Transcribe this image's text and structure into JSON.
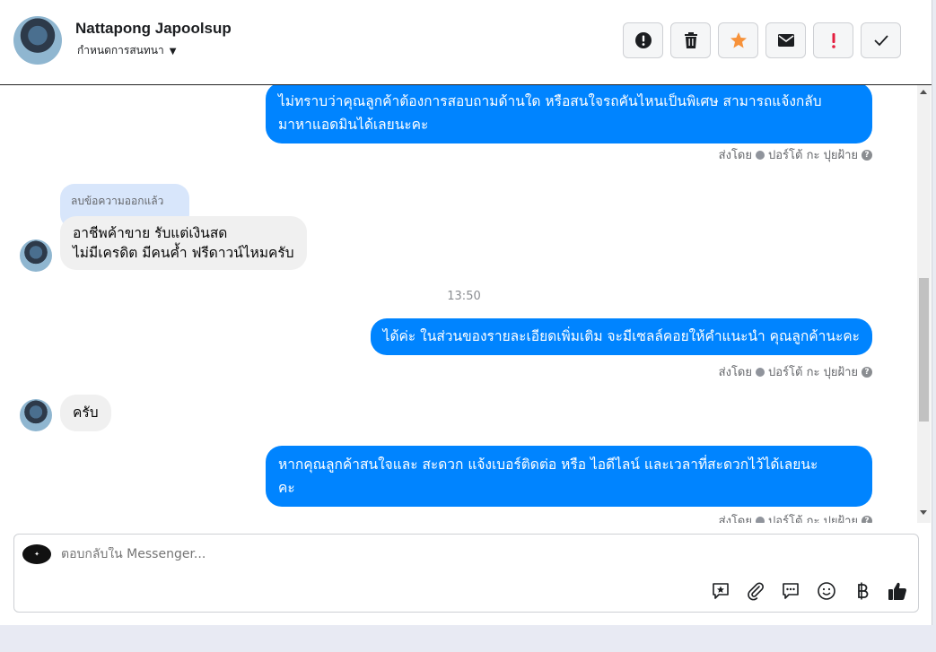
{
  "header": {
    "name": "Nattapong Japoolsup",
    "subtitle": "กำหนดการสนทนา",
    "actions": [
      "info-icon",
      "trash-icon",
      "star-icon",
      "mail-icon",
      "exclamation-icon",
      "check-icon"
    ],
    "star_color": "#f7923a",
    "exclamation_color": "#e41e3f"
  },
  "messages": {
    "m1": {
      "line1": "ไม่ทราบว่าคุณลูกค้าต้องการสอบถามด้านใด หรือสนใจรถคันไหนเป็นพิเศษ สามารถแจ้งกลับ",
      "line2": "มาหาแอดมินได้เลยนะคะ"
    },
    "sent_by_1": {
      "prefix": "ส่งโดย",
      "name": "ปอร์โต้ กะ ปุยฝ้าย"
    },
    "deleted_label": "ลบข้อความออกแล้ว",
    "m2": {
      "line1": "อาชีพค้าขาย รับแต่เงินสด",
      "line2": "ไม่มีเครดิต มีคนค้ำ ฟรีดาวน์ไหมครับ"
    },
    "timestamp": "13:50",
    "m3": "ได้ค่ะ  ในส่วนของรายละเอียดเพิ่มเติม จะมีเซลล์คอยให้คำแนะนำ คุณลูกค้านะคะ",
    "sent_by_2": {
      "prefix": "ส่งโดย",
      "name": "ปอร์โต้ กะ ปุยฝ้าย"
    },
    "m4": "ครับ",
    "m5": {
      "line1": "หากคุณลูกค้าสนใจและ สะดวก แจ้งเบอร์ติดต่อ หรือ ไอดีไลน์ และเวลาที่สะดวกไว้ได้เลยนะ",
      "line2": "คะ"
    },
    "sent_by_3": {
      "prefix": "ส่งโดย",
      "name": "ปอร์โต้ กะ ปุยฝ้าย"
    }
  },
  "composer": {
    "placeholder": "ตอบกลับใน Messenger...",
    "tools": [
      "saved-reply-icon",
      "attachment-icon",
      "chat-icon",
      "emoji-icon",
      "baht-icon",
      "like-icon"
    ]
  },
  "colors": {
    "outgoing": "#0084ff",
    "incoming": "#f0f0f0",
    "deleted": "#d8e6fb"
  }
}
